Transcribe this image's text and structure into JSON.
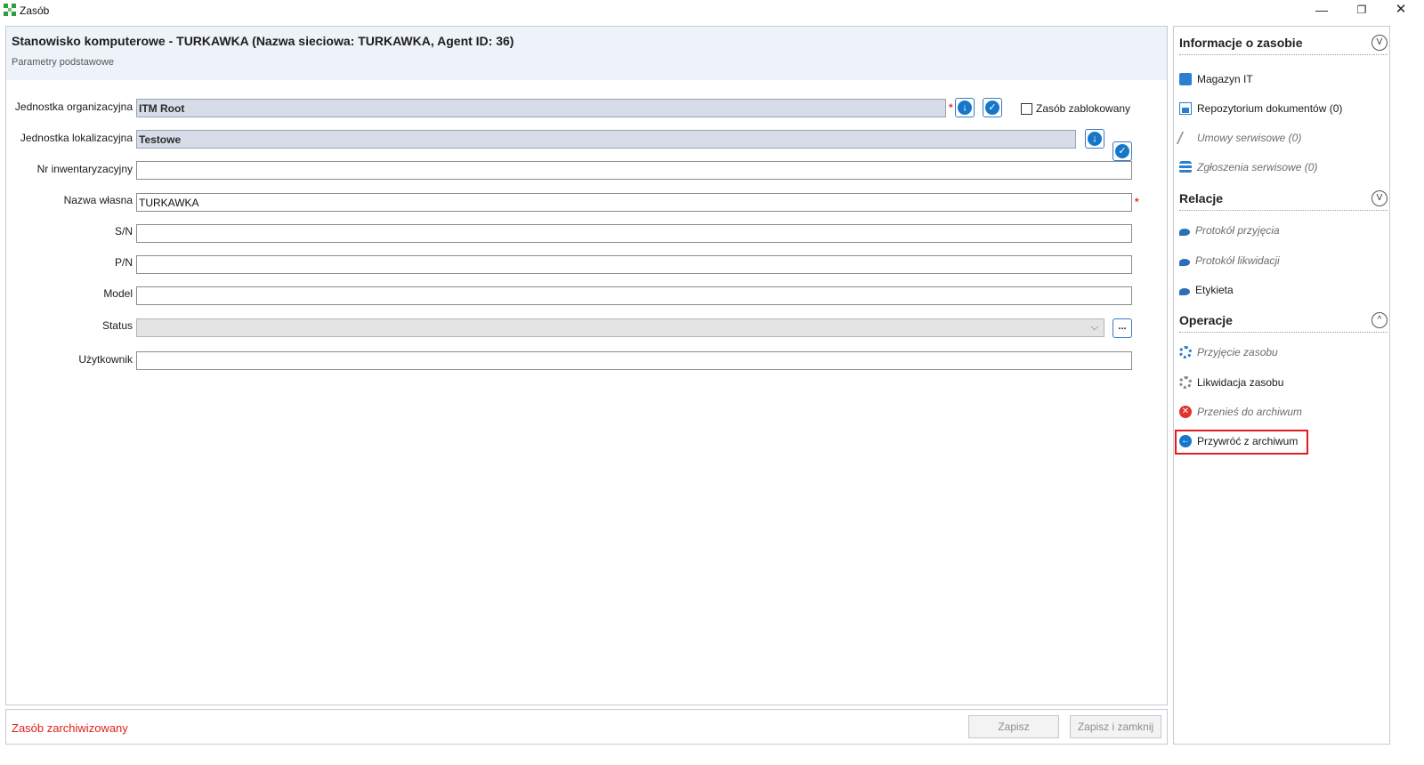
{
  "window": {
    "title": "Zasób",
    "minimize_glyph": "—",
    "restore_glyph": "❐",
    "close_glyph": "✕"
  },
  "header": {
    "title": "Stanowisko komputerowe - TURKAWKA (Nazwa sieciowa: TURKAWKA, Agent ID: 36)",
    "subtitle": "Parametry podstawowe"
  },
  "form": {
    "org_unit": {
      "label": "Jednostka organizacyjna",
      "value": "ITM Root"
    },
    "location_unit": {
      "label": "Jednostka lokalizacyjna",
      "value": "Testowe"
    },
    "inventory_no": {
      "label": "Nr inwentaryzacyjny",
      "value": ""
    },
    "own_name": {
      "label": "Nazwa własna",
      "value": "TURKAWKA"
    },
    "serial": {
      "label": "S/N",
      "value": ""
    },
    "part_no": {
      "label": "P/N",
      "value": ""
    },
    "model": {
      "label": "Model",
      "value": ""
    },
    "status": {
      "label": "Status",
      "value": ""
    },
    "user": {
      "label": "Użytkownik",
      "value": ""
    },
    "locked_checkbox_label": "Zasób zablokowany",
    "required_marker": "*",
    "browse_button_label": "..."
  },
  "footer": {
    "status_text": "Zasób zarchiwizowany",
    "save_label": "Zapisz",
    "save_close_label": "Zapisz i zamknij"
  },
  "side": {
    "info": {
      "title": "Informacje o zasobie",
      "toggle": "V",
      "items": [
        {
          "label": "Magazyn IT",
          "icon": "warehouse-icon"
        },
        {
          "label": "Repozytorium dokumentów (0)",
          "icon": "document-icon"
        },
        {
          "label": "Umowy serwisowe (0)",
          "icon": "pen-icon"
        },
        {
          "label": "Zgłoszenia serwisowe (0)",
          "icon": "stack-icon"
        }
      ]
    },
    "relations": {
      "title": "Relacje",
      "toggle": "V",
      "items": [
        {
          "label": "Protokół przyjęcia",
          "icon": "bird-icon"
        },
        {
          "label": "Protokół likwidacji",
          "icon": "bird-icon"
        },
        {
          "label": "Etykieta",
          "icon": "bird-icon"
        }
      ]
    },
    "operations": {
      "title": "Operacje",
      "toggle": "^",
      "items": [
        {
          "label": "Przyjęcie zasobu",
          "icon": "gear-icon"
        },
        {
          "label": "Likwidacja zasobu",
          "icon": "gear-icon"
        },
        {
          "label": "Przenieś do archiwum",
          "icon": "close-circle-icon"
        },
        {
          "label": "Przywróć z archiwum",
          "icon": "arrow-left-circle-icon"
        }
      ]
    }
  },
  "colors": {
    "accent": "#1677c9",
    "header_band": "#eef3fa",
    "danger": "#e0201b"
  }
}
